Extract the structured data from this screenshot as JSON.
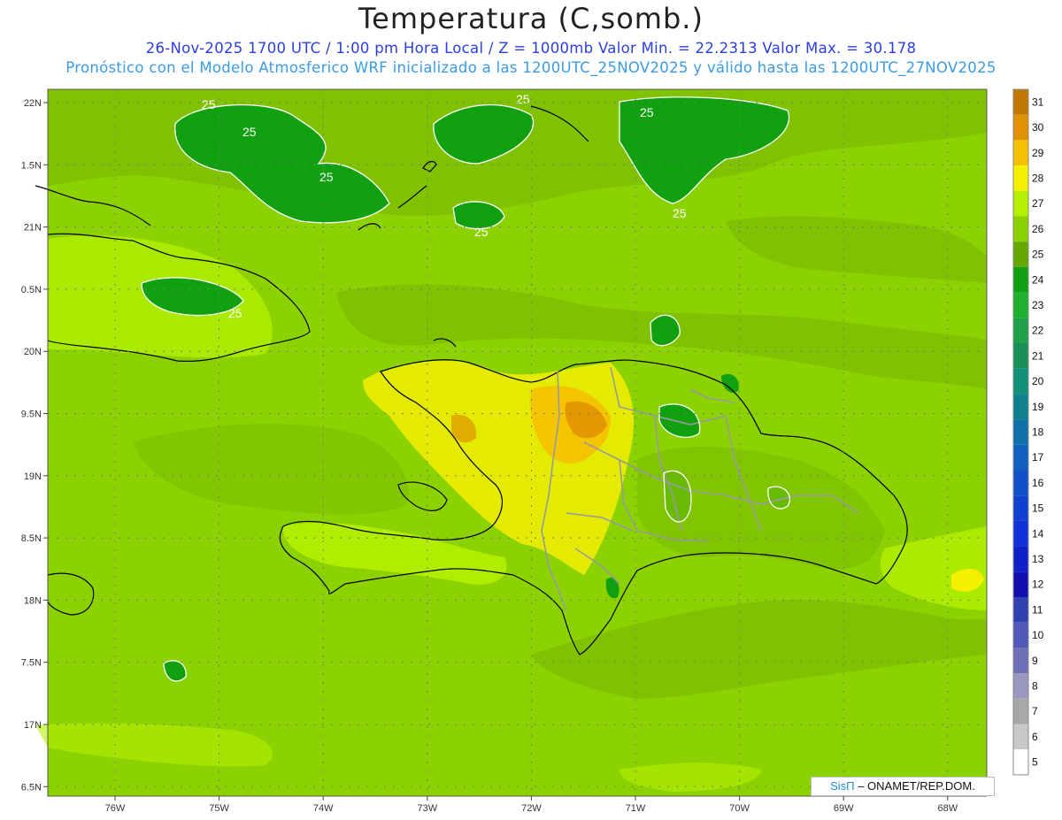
{
  "header": {
    "title": "Temperatura (C,somb.)",
    "line1": "26-Nov-2025  1700 UTC / 1:00 pm Hora Local / Z = 1000mb    Valor Min. = 22.2313  Valor Max. = 30.178",
    "line2": "Pronóstico con el Modelo Atmosferico WRF inicializado a las 1200UTC_25NOV2025 y válido hasta las  1200UTC_27NOV2025"
  },
  "axes": {
    "lat_labels": [
      "22N",
      "1.5N",
      "21N",
      "0.5N",
      "20N",
      "9.5N",
      "19N",
      "8.5N",
      "18N",
      "7.5N",
      "17N",
      "6.5N"
    ],
    "lon_labels": [
      "76W",
      "75W",
      "74W",
      "73W",
      "72W",
      "71W",
      "70W",
      "69W",
      "68W"
    ]
  },
  "contour_labels": [
    "25",
    "25",
    "25",
    "25",
    "25",
    "25",
    "25",
    "25"
  ],
  "colorbar": {
    "levels": [
      "31",
      "30",
      "29",
      "28",
      "27",
      "26",
      "25",
      "24",
      "23",
      "22",
      "21",
      "20",
      "19",
      "18",
      "17",
      "16",
      "15",
      "14",
      "13",
      "12",
      "11",
      "10",
      "9",
      "8",
      "7",
      "6",
      "5"
    ],
    "colors": [
      "#c07800",
      "#e09000",
      "#f5c000",
      "#f5f000",
      "#b4f000",
      "#8cd200",
      "#64a800",
      "#10a010",
      "#20b030",
      "#20a048",
      "#189058",
      "#109078",
      "#108090",
      "#1070a8",
      "#1060c0",
      "#1050c8",
      "#1040d0",
      "#1030d8",
      "#1020c8",
      "#1010b0",
      "#3040b0",
      "#5058b8",
      "#7070b8",
      "#9898c0",
      "#a8a8a8",
      "#c8c8c8",
      "#ffffff"
    ]
  },
  "credit": {
    "sis": "SisΠ",
    "rest": "– ONAMET/REP.DOM."
  }
}
